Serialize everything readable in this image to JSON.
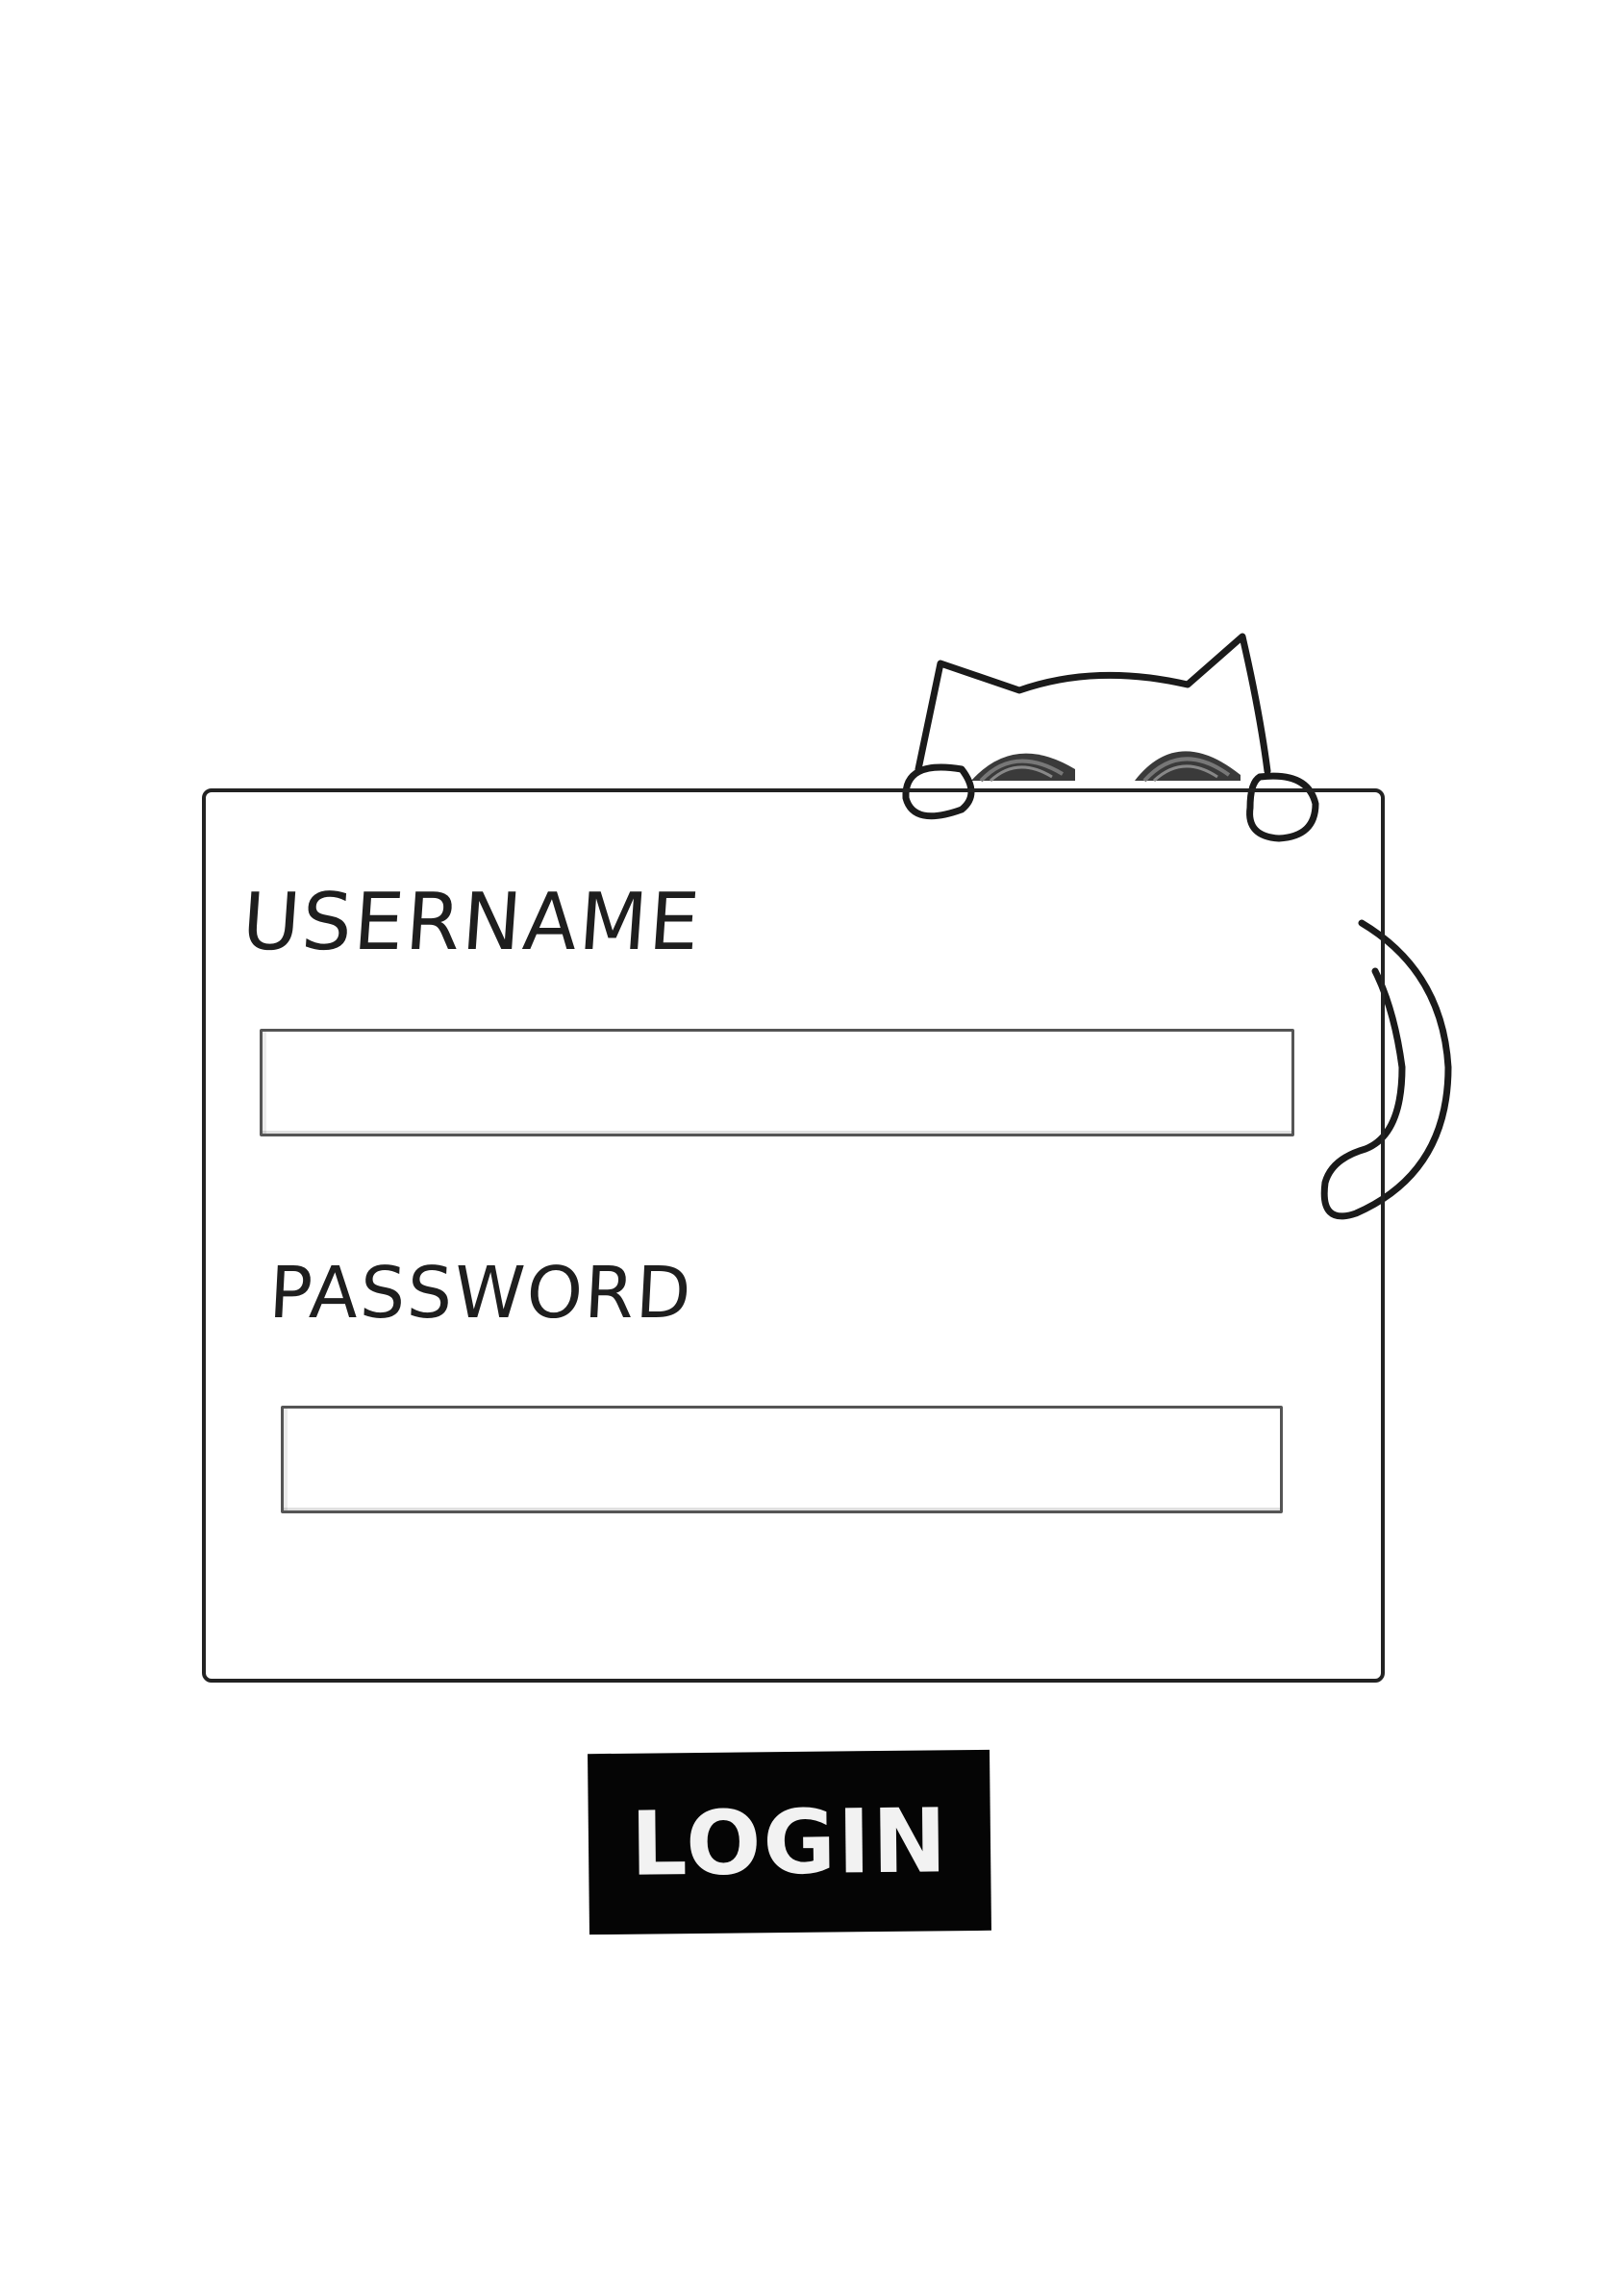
{
  "form": {
    "username_label": "USERNAME",
    "username_value": "",
    "password_label": "PASSWORD",
    "password_value": "",
    "login_label": "LOGIN"
  },
  "illustration": {
    "icon": "cat-peeking-icon",
    "stroke_color": "#1a1a1a"
  }
}
